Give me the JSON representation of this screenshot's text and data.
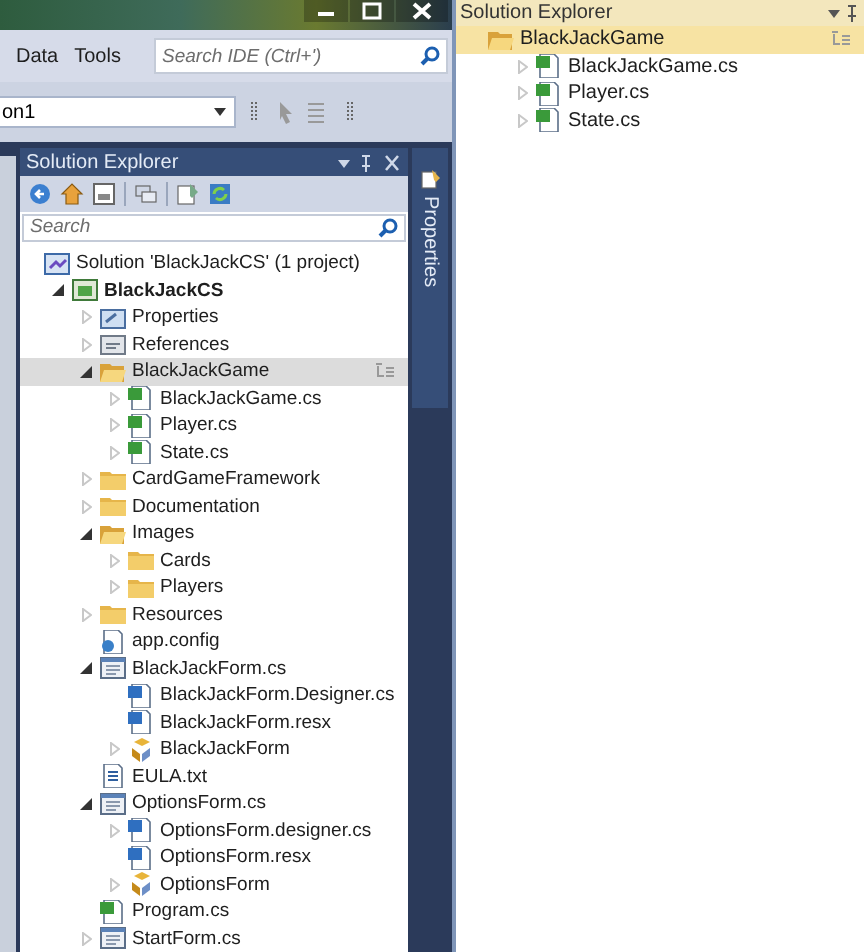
{
  "main_window": {
    "menu": [
      "Data",
      "Tools"
    ],
    "search": {
      "placeholder": "Search IDE (Ctrl+')"
    },
    "config_combo": {
      "value": "on1"
    }
  },
  "solution_explorer": {
    "title": "Solution Explorer",
    "search": {
      "placeholder": "Search"
    },
    "side_tab": "Properties",
    "tree": [
      {
        "label": "Solution 'BlackJackCS' (1 project)",
        "kind": "solution",
        "selected": false,
        "children": [
          {
            "label": "BlackJackCS",
            "kind": "project",
            "bold": true,
            "expanded": true,
            "selected": false,
            "children": [
              {
                "label": "Properties",
                "kind": "properties",
                "expanded": false,
                "selected": false
              },
              {
                "label": "References",
                "kind": "references",
                "expanded": false,
                "selected": false
              },
              {
                "label": "BlackJackGame",
                "kind": "folder-open",
                "expanded": true,
                "selected": true,
                "children": [
                  {
                    "label": "BlackJackGame.cs",
                    "kind": "cs",
                    "expanded": false,
                    "selected": false
                  },
                  {
                    "label": "Player.cs",
                    "kind": "cs",
                    "expanded": false,
                    "selected": false
                  },
                  {
                    "label": "State.cs",
                    "kind": "cs",
                    "expanded": false,
                    "selected": false
                  }
                ]
              },
              {
                "label": "CardGameFramework",
                "kind": "folder",
                "expanded": false,
                "selected": false
              },
              {
                "label": "Documentation",
                "kind": "folder",
                "expanded": false,
                "selected": false
              },
              {
                "label": "Images",
                "kind": "folder-open",
                "expanded": true,
                "selected": false,
                "children": [
                  {
                    "label": "Cards",
                    "kind": "folder",
                    "expanded": false,
                    "selected": false
                  },
                  {
                    "label": "Players",
                    "kind": "folder",
                    "expanded": false,
                    "selected": false
                  }
                ]
              },
              {
                "label": "Resources",
                "kind": "folder",
                "expanded": false,
                "selected": false
              },
              {
                "label": "app.config",
                "kind": "config",
                "selected": false
              },
              {
                "label": "BlackJackForm.cs",
                "kind": "form",
                "expanded": true,
                "selected": false,
                "children": [
                  {
                    "label": "BlackJackForm.Designer.cs",
                    "kind": "designer",
                    "selected": false
                  },
                  {
                    "label": "BlackJackForm.resx",
                    "kind": "designer",
                    "selected": false
                  },
                  {
                    "label": "BlackJackForm",
                    "kind": "class",
                    "expanded": false,
                    "selected": false
                  }
                ]
              },
              {
                "label": "EULA.txt",
                "kind": "txt",
                "selected": false
              },
              {
                "label": "OptionsForm.cs",
                "kind": "form",
                "expanded": true,
                "selected": false,
                "children": [
                  {
                    "label": "OptionsForm.designer.cs",
                    "kind": "designer",
                    "expanded": false,
                    "selected": false
                  },
                  {
                    "label": "OptionsForm.resx",
                    "kind": "designer",
                    "selected": false
                  },
                  {
                    "label": "OptionsForm",
                    "kind": "class",
                    "expanded": false,
                    "selected": false
                  }
                ]
              },
              {
                "label": "Program.cs",
                "kind": "cs",
                "selected": false
              },
              {
                "label": "StartForm.cs",
                "kind": "form",
                "expanded": false,
                "selected": false
              }
            ]
          }
        ]
      }
    ]
  },
  "scoped_explorer": {
    "title": "Solution Explorer",
    "tree": [
      {
        "label": "BlackJackGame",
        "kind": "folder-open",
        "selected": true,
        "children": [
          {
            "label": "BlackJackGame.cs",
            "kind": "cs",
            "expanded": false,
            "selected": false
          },
          {
            "label": "Player.cs",
            "kind": "cs",
            "expanded": false,
            "selected": false
          },
          {
            "label": "State.cs",
            "kind": "cs",
            "expanded": false,
            "selected": false
          }
        ]
      }
    ]
  }
}
